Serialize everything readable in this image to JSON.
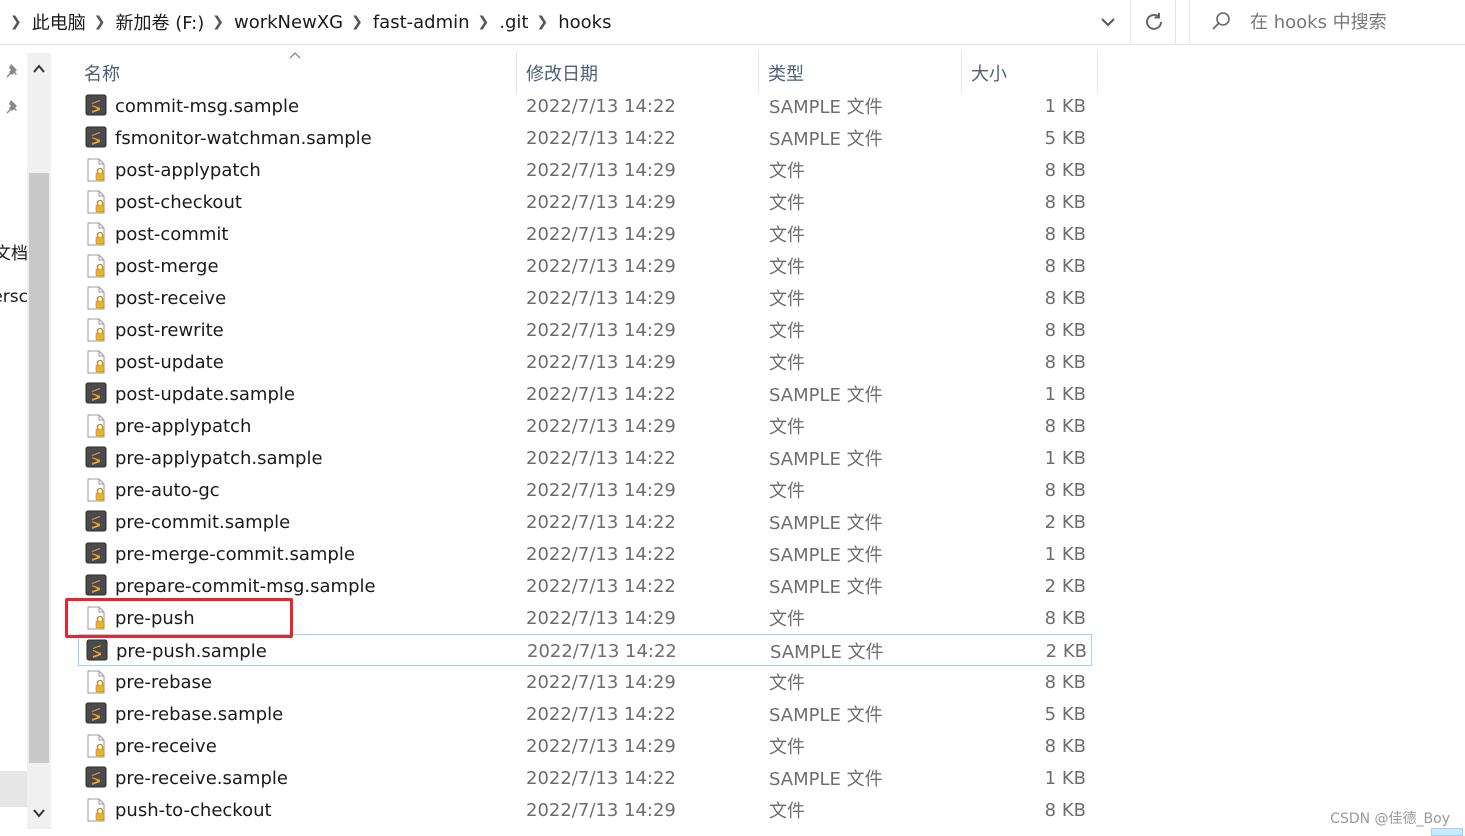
{
  "breadcrumb": [
    "此电脑",
    "新加卷 (F:)",
    "workNewXG",
    "fast-admin",
    ".git",
    "hooks"
  ],
  "search": {
    "placeholder": "在 hooks 中搜索"
  },
  "nav_fragments": [
    "文档",
    "ersc"
  ],
  "columns": {
    "name": "名称",
    "date": "修改日期",
    "type": "类型",
    "size": "大小"
  },
  "files": [
    {
      "name": "commit-msg.sample",
      "date": "2022/7/13 14:22",
      "type": "SAMPLE 文件",
      "size": "1 KB",
      "icon": "sublime-text-icon"
    },
    {
      "name": "fsmonitor-watchman.sample",
      "date": "2022/7/13 14:22",
      "type": "SAMPLE 文件",
      "size": "5 KB",
      "icon": "sublime-text-icon"
    },
    {
      "name": "post-applypatch",
      "date": "2022/7/13 14:29",
      "type": "文件",
      "size": "8 KB",
      "icon": "locked-file-icon"
    },
    {
      "name": "post-checkout",
      "date": "2022/7/13 14:29",
      "type": "文件",
      "size": "8 KB",
      "icon": "locked-file-icon"
    },
    {
      "name": "post-commit",
      "date": "2022/7/13 14:29",
      "type": "文件",
      "size": "8 KB",
      "icon": "locked-file-icon"
    },
    {
      "name": "post-merge",
      "date": "2022/7/13 14:29",
      "type": "文件",
      "size": "8 KB",
      "icon": "locked-file-icon"
    },
    {
      "name": "post-receive",
      "date": "2022/7/13 14:29",
      "type": "文件",
      "size": "8 KB",
      "icon": "locked-file-icon"
    },
    {
      "name": "post-rewrite",
      "date": "2022/7/13 14:29",
      "type": "文件",
      "size": "8 KB",
      "icon": "locked-file-icon"
    },
    {
      "name": "post-update",
      "date": "2022/7/13 14:29",
      "type": "文件",
      "size": "8 KB",
      "icon": "locked-file-icon"
    },
    {
      "name": "post-update.sample",
      "date": "2022/7/13 14:22",
      "type": "SAMPLE 文件",
      "size": "1 KB",
      "icon": "sublime-text-icon"
    },
    {
      "name": "pre-applypatch",
      "date": "2022/7/13 14:29",
      "type": "文件",
      "size": "8 KB",
      "icon": "locked-file-icon"
    },
    {
      "name": "pre-applypatch.sample",
      "date": "2022/7/13 14:22",
      "type": "SAMPLE 文件",
      "size": "1 KB",
      "icon": "sublime-text-icon"
    },
    {
      "name": "pre-auto-gc",
      "date": "2022/7/13 14:29",
      "type": "文件",
      "size": "8 KB",
      "icon": "locked-file-icon"
    },
    {
      "name": "pre-commit.sample",
      "date": "2022/7/13 14:22",
      "type": "SAMPLE 文件",
      "size": "2 KB",
      "icon": "sublime-text-icon"
    },
    {
      "name": "pre-merge-commit.sample",
      "date": "2022/7/13 14:22",
      "type": "SAMPLE 文件",
      "size": "1 KB",
      "icon": "sublime-text-icon"
    },
    {
      "name": "prepare-commit-msg.sample",
      "date": "2022/7/13 14:22",
      "type": "SAMPLE 文件",
      "size": "2 KB",
      "icon": "sublime-text-icon"
    },
    {
      "name": "pre-push",
      "date": "2022/7/13 14:29",
      "type": "文件",
      "size": "8 KB",
      "icon": "locked-file-icon"
    },
    {
      "name": "pre-push.sample",
      "date": "2022/7/13 14:22",
      "type": "SAMPLE 文件",
      "size": "2 KB",
      "icon": "sublime-text-icon",
      "selected": true
    },
    {
      "name": "pre-rebase",
      "date": "2022/7/13 14:29",
      "type": "文件",
      "size": "8 KB",
      "icon": "locked-file-icon"
    },
    {
      "name": "pre-rebase.sample",
      "date": "2022/7/13 14:22",
      "type": "SAMPLE 文件",
      "size": "5 KB",
      "icon": "sublime-text-icon"
    },
    {
      "name": "pre-receive",
      "date": "2022/7/13 14:29",
      "type": "文件",
      "size": "8 KB",
      "icon": "locked-file-icon"
    },
    {
      "name": "pre-receive.sample",
      "date": "2022/7/13 14:22",
      "type": "SAMPLE 文件",
      "size": "1 KB",
      "icon": "sublime-text-icon"
    },
    {
      "name": "push-to-checkout",
      "date": "2022/7/13 14:29",
      "type": "文件",
      "size": "8 KB",
      "icon": "locked-file-icon"
    }
  ],
  "colors": {
    "highlight": "#e8252a",
    "selection_border": "#99d1ff",
    "header_text": "#4c607a"
  },
  "watermark": "CSDN @佳德_Boy"
}
